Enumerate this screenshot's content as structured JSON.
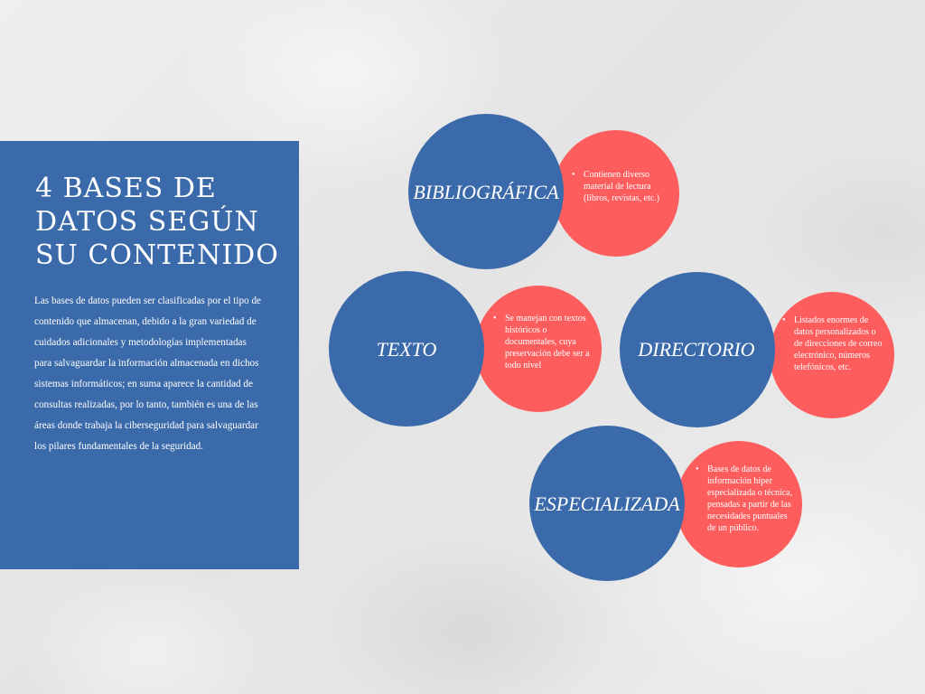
{
  "panel": {
    "title": "4 BASES DE DATOS SEGÚN SU CONTENIDO",
    "description": "Las bases de datos pueden ser clasificadas por el tipo de contenido que almacenan, debido a la gran variedad de cuidados adicionales y metodologías implementadas para salvaguardar la información almacenada en dichos sistemas informáticos; en suma aparece la cantidad de consultas realizadas, por lo tanto, también es una de las áreas donde trabaja la ciberseguridad para salvaguardar los pilares fundamentales de la seguridad."
  },
  "nodes": [
    {
      "label": "BIBLIOGRÁFICA",
      "detail": "Contienen diverso material de lectura (libros, revistas, etc.)"
    },
    {
      "label": "TEXTO",
      "detail": "Se manejan con textos históricos o documentales, cuya preservación debe ser a todo nivel"
    },
    {
      "label": "DIRECTORIO",
      "detail": "Listados enormes de datos personalizados o de direcciones de correo electrónico, números telefónicos, etc."
    },
    {
      "label": "ESPECIALIZADA",
      "detail": "Bases de datos de información híper especializada o técnica, pensadas a partir de las necesidades puntuales de un público."
    }
  ],
  "colors": {
    "blue": "#3b6aaa",
    "red": "#fe5d5d",
    "background": "#e9e9e9"
  },
  "bullet_glyph": "•"
}
